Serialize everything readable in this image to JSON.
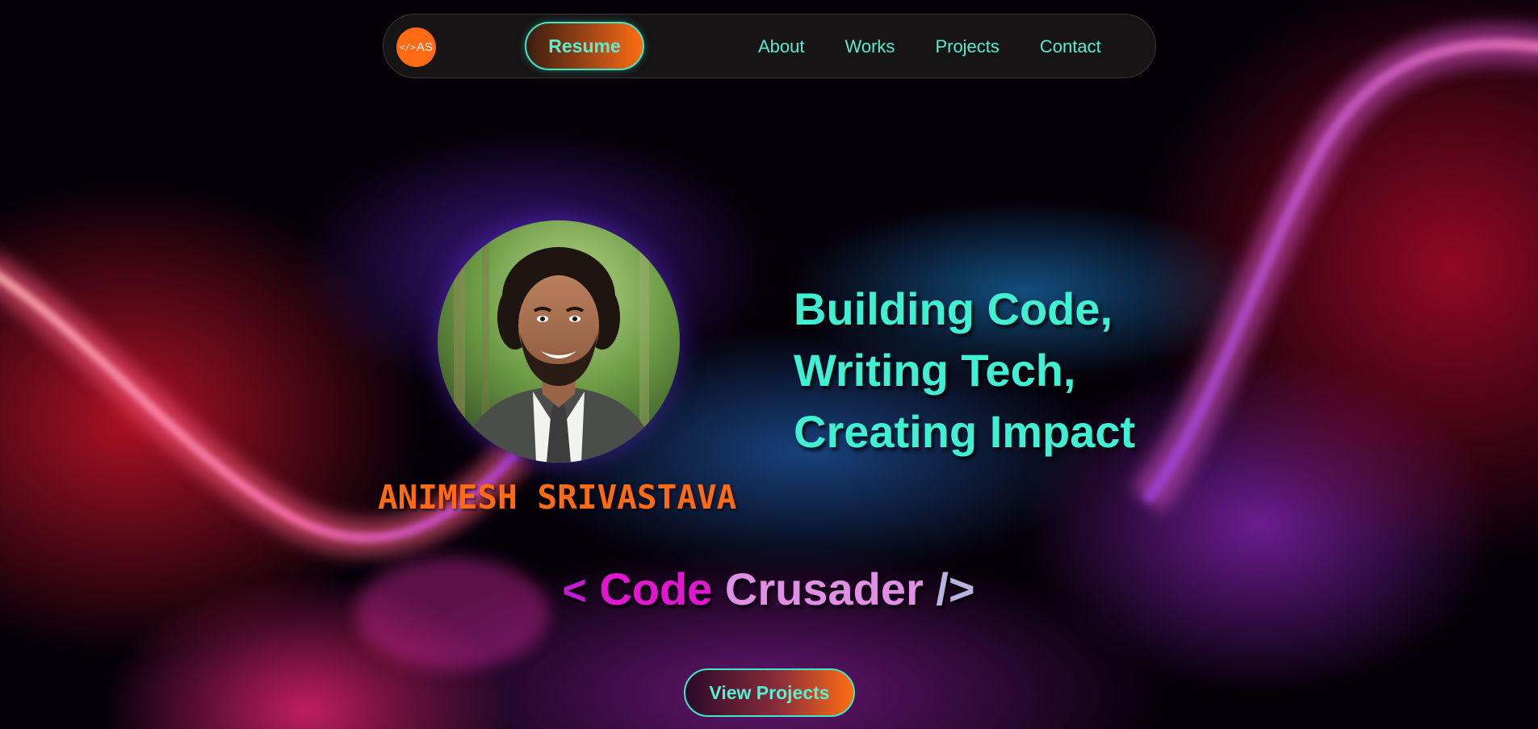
{
  "nav": {
    "logo_text": "AS",
    "logo_glyph": "</>",
    "resume_label": "Resume",
    "links": [
      {
        "label": "About"
      },
      {
        "label": "Works"
      },
      {
        "label": "Projects"
      },
      {
        "label": "Contact"
      }
    ]
  },
  "hero": {
    "name": "ANIMESH SRIVASTAVA",
    "headline": [
      "Building Code,",
      "Writing Tech,",
      "Creating Impact"
    ],
    "tagline": {
      "open": "<",
      "word1": "Code",
      "word2": "Crusader",
      "close": "/>"
    },
    "cta_label": "View Projects"
  },
  "colors": {
    "accent_teal": "#40f0d2",
    "accent_orange": "#ff6a13",
    "nav_bg": "#181616"
  },
  "icons": {
    "logo": "code-brackets-icon",
    "avatar": "profile-photo"
  }
}
